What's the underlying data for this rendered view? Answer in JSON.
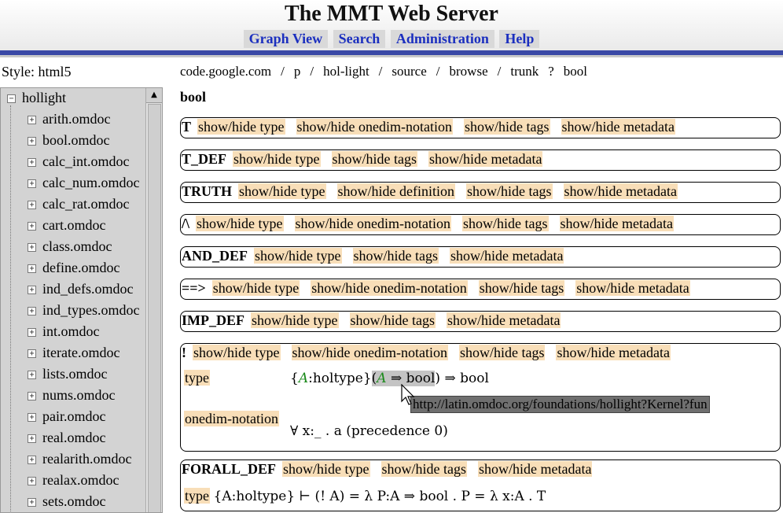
{
  "header": {
    "title": "The MMT Web Server",
    "nav": [
      "Graph View",
      "Search",
      "Administration",
      "Help"
    ]
  },
  "style_label": "Style: html5",
  "sidebar": {
    "root": "hollight",
    "items": [
      "arith.omdoc",
      "bool.omdoc",
      "calc_int.omdoc",
      "calc_num.omdoc",
      "calc_rat.omdoc",
      "cart.omdoc",
      "class.omdoc",
      "define.omdoc",
      "ind_defs.omdoc",
      "ind_types.omdoc",
      "int.omdoc",
      "iterate.omdoc",
      "lists.omdoc",
      "nums.omdoc",
      "pair.omdoc",
      "real.omdoc",
      "realarith.omdoc",
      "realax.omdoc",
      "sets.omdoc"
    ]
  },
  "breadcrumb": [
    "code.google.com",
    "/",
    "p",
    "/",
    "hol-light",
    "/",
    "source",
    "/",
    "browse",
    "/",
    "trunk",
    "?",
    "bool"
  ],
  "heading": "bool",
  "declarations": [
    {
      "name": "T",
      "tags": [
        "show/hide type",
        "show/hide onedim-notation",
        "show/hide tags",
        "show/hide metadata"
      ]
    },
    {
      "name": "T_DEF",
      "tags": [
        "show/hide type",
        "show/hide tags",
        "show/hide metadata"
      ]
    },
    {
      "name": "TRUTH",
      "tags": [
        "show/hide type",
        "show/hide definition",
        "show/hide tags",
        "show/hide metadata"
      ]
    },
    {
      "name": "/\\",
      "tags": [
        "show/hide type",
        "show/hide onedim-notation",
        "show/hide tags",
        "show/hide metadata"
      ]
    },
    {
      "name": "AND_DEF",
      "tags": [
        "show/hide type",
        "show/hide tags",
        "show/hide metadata"
      ]
    },
    {
      "name": "==>",
      "tags": [
        "show/hide type",
        "show/hide onedim-notation",
        "show/hide tags",
        "show/hide metadata"
      ]
    },
    {
      "name": "IMP_DEF",
      "tags": [
        "show/hide type",
        "show/hide tags",
        "show/hide metadata"
      ]
    },
    {
      "name": "!",
      "tags": [
        "show/hide type",
        "show/hide onedim-notation",
        "show/hide tags",
        "show/hide metadata"
      ]
    },
    {
      "name": "FORALL_DEF",
      "tags": [
        "show/hide type",
        "show/hide tags",
        "show/hide metadata"
      ]
    }
  ],
  "forall": {
    "type_label": "type",
    "type_expr_a": "{",
    "type_var": "A",
    "type_colon": ":holtype}",
    "type_sel_var": "A",
    "type_sel_rest": "⇒ bool",
    "type_tail": ") ⇒ bool",
    "onedim_label": "onedim-notation",
    "onedim_value": "∀ x:_ . a (precedence 0)",
    "tooltip": "http://latin.omdoc.org/foundations/hollight?Kernel?fun"
  },
  "forall_def": {
    "type_label": "type",
    "expr": "{A:holtype} ⊢ (! A) =  λ P:A ⇒ bool . P =  λ x:A . T"
  },
  "colors": {
    "nav_link": "#1b2fbf",
    "accent_bar": "#3a49a6",
    "tag_bg": "#f8deb8",
    "math_var": "#1b8a1b"
  }
}
